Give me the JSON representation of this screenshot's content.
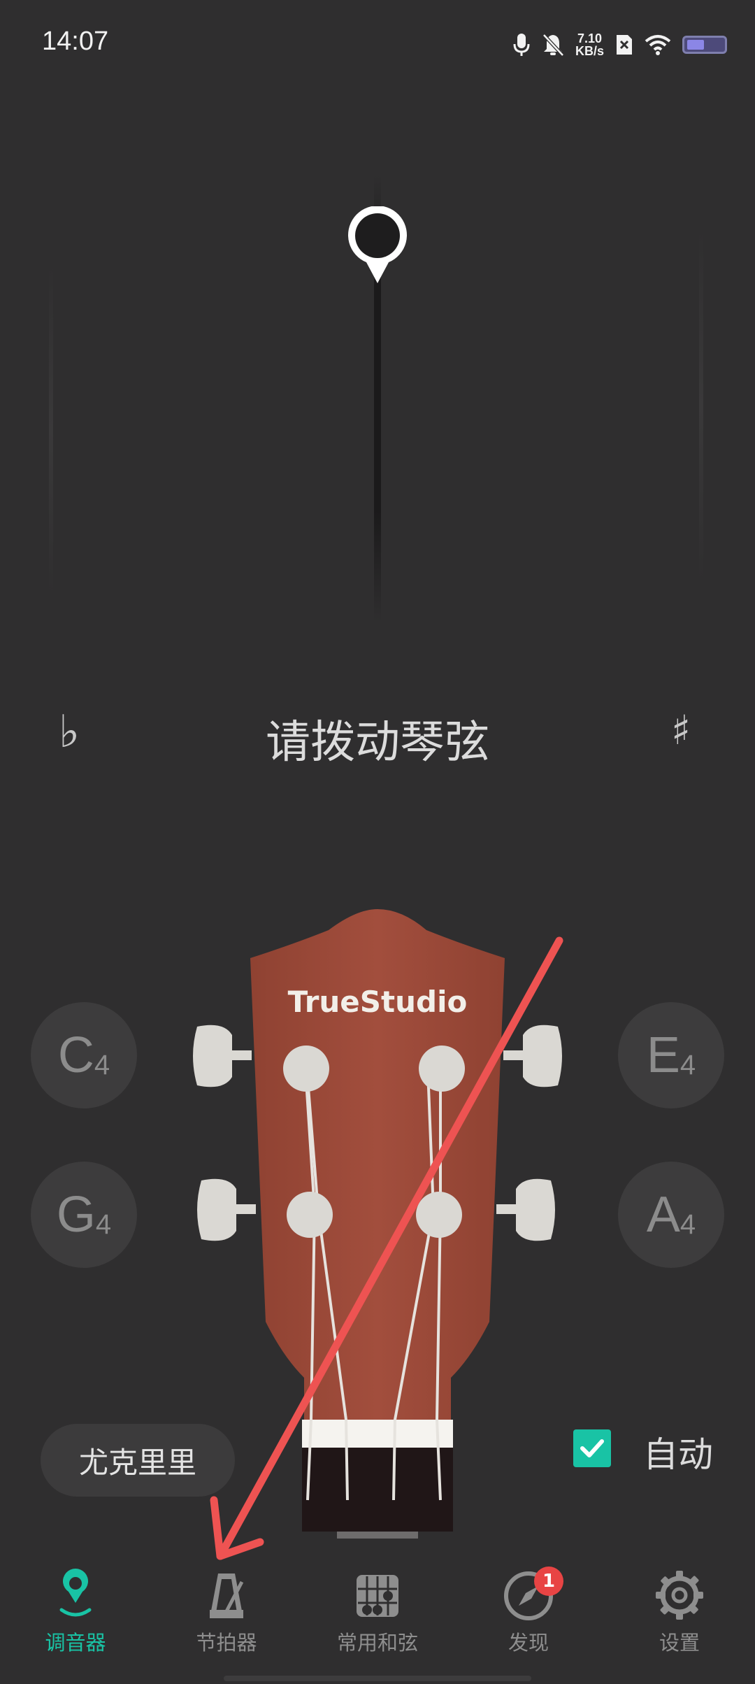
{
  "status_bar": {
    "time": "14:07",
    "net_speed_value": "7.10",
    "net_speed_unit": "KB/s",
    "icons": [
      "microphone-icon",
      "bell-muted-icon",
      "sim-blocked-icon",
      "wifi-icon",
      "battery-icon"
    ]
  },
  "tuner": {
    "hint": "请拨动琴弦",
    "flat_symbol": "♭",
    "sharp_symbol": "♯"
  },
  "strings": {
    "left_top": {
      "note": "C",
      "octave": "4"
    },
    "left_bottom": {
      "note": "G",
      "octave": "4"
    },
    "right_top": {
      "note": "E",
      "octave": "4"
    },
    "right_bottom": {
      "note": "A",
      "octave": "4"
    }
  },
  "headstock": {
    "brand": "TrueStudio"
  },
  "controls": {
    "instrument": "尤克里里",
    "auto_label": "自动",
    "auto_checked": true
  },
  "nav": {
    "items": [
      {
        "label": "调音器",
        "icon": "tuner-pin-icon",
        "active": true
      },
      {
        "label": "节拍器",
        "icon": "metronome-icon",
        "active": false
      },
      {
        "label": "常用和弦",
        "icon": "chord-grid-icon",
        "active": false
      },
      {
        "label": "发现",
        "icon": "compass-icon",
        "active": false,
        "badge": "1"
      },
      {
        "label": "设置",
        "icon": "gear-icon",
        "active": false
      }
    ]
  },
  "colors": {
    "accent": "#19c3a5",
    "background": "#2f2e2f",
    "headstock": "#9c4a3a",
    "badge": "#e84444",
    "annotation_arrow": "#ee5352"
  }
}
